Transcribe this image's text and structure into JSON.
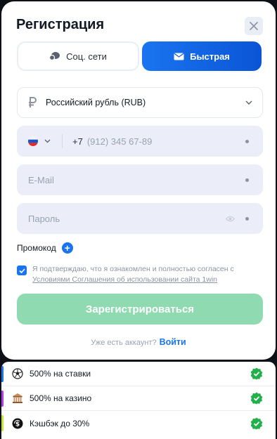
{
  "dialog": {
    "title": "Регистрация"
  },
  "tabs": [
    {
      "label": "Соц. сети",
      "icon": "chat-bubbles-icon",
      "active": false
    },
    {
      "label": "Быстрая",
      "icon": "envelope-icon",
      "active": true
    }
  ],
  "form": {
    "currency": {
      "value": "Российский рубль (RUB)",
      "icon": "ruble-icon"
    },
    "phone": {
      "country_flag": "russia-flag-icon",
      "code": "+7",
      "placeholder": "(912) 345 67-89"
    },
    "email": {
      "placeholder": "E-Mail"
    },
    "password": {
      "placeholder": "Пароль"
    },
    "promo_label": "Промокод",
    "agreement": {
      "checked": true,
      "text": "Я подтверждаю, что я ознакомлен и полностью согласен с",
      "link_text": "Условиями Соглашения об использовании сайта 1win"
    },
    "submit_label": "Зарегистрироваться",
    "have_account_text": "Уже есть аккаунт?",
    "login_link": "Войти"
  },
  "bonuses": [
    {
      "label": "500% на ставки",
      "icon": "soccer-ball-icon",
      "bar_color": "#1a74f0"
    },
    {
      "label": "500% на казино",
      "icon": "casino-building-icon",
      "bar_color": "#b43cf0"
    },
    {
      "label": "Кэшбэк до 30%",
      "icon": "cashback-icon",
      "bar_color": "#c7e635"
    }
  ],
  "colors": {
    "accent": "#1a74f0",
    "submit_disabled": "#8fdab0",
    "check_badge": "#22b04b"
  }
}
